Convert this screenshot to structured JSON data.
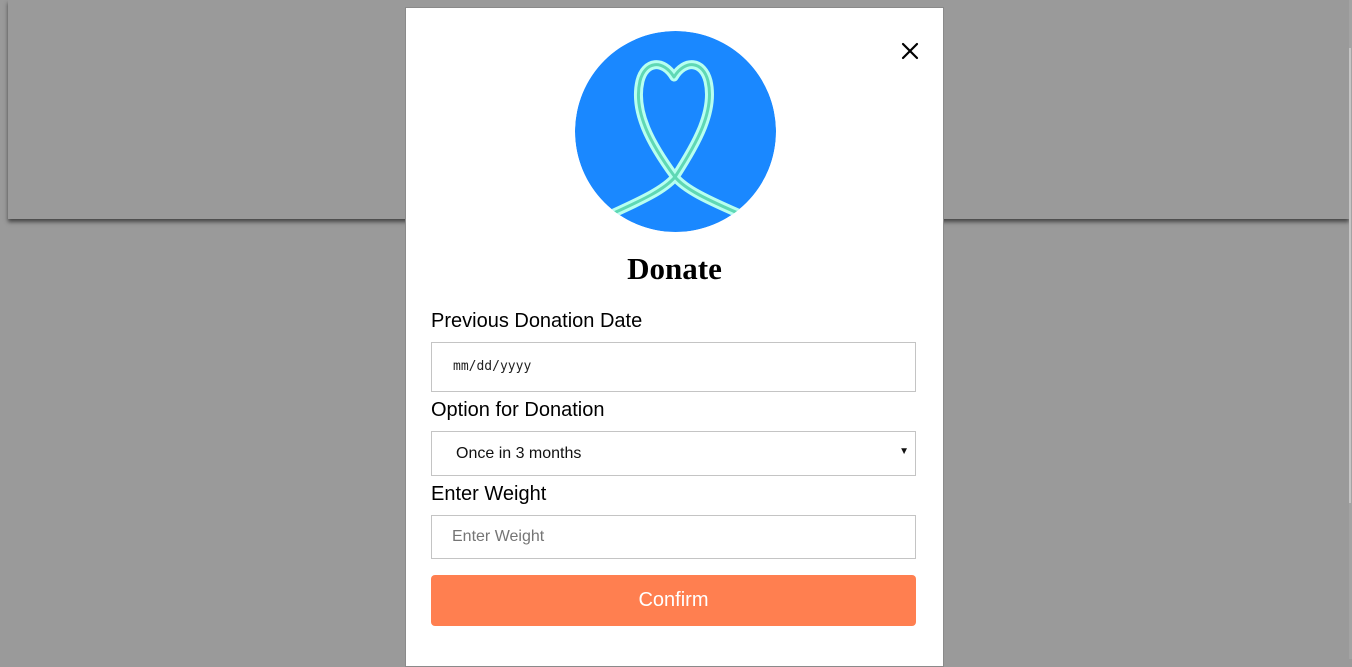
{
  "modal": {
    "title": "Donate",
    "close_icon": "close-icon",
    "logo_icon": "heart-ribbon-icon"
  },
  "form": {
    "previous_date": {
      "label": "Previous Donation Date",
      "placeholder": "mm/dd/yyyy"
    },
    "option": {
      "label": "Option for Donation",
      "selected": "Once in 3 months"
    },
    "weight": {
      "label": "Enter Weight",
      "placeholder": "Enter Weight",
      "value": ""
    },
    "confirm_label": "Confirm"
  },
  "colors": {
    "accent": "#ff7f50",
    "logo_bg": "#1a88ff",
    "ribbon": "#8ff0d0",
    "overlay": "#9a9a9a"
  }
}
